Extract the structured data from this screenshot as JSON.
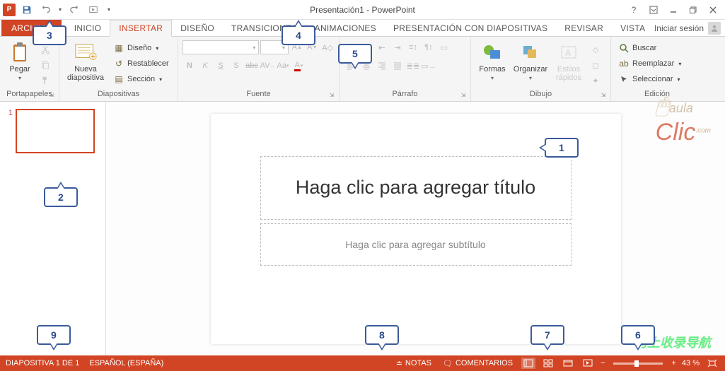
{
  "title": "Presentación1 - PowerPoint",
  "signin": "Iniciar sesión",
  "tabs": {
    "file": "ARCHIVO",
    "home": "INICIO",
    "insert": "INSERTAR",
    "design": "DISEÑO",
    "transitions": "TRANSICIONES",
    "animations": "ANIMACIONES",
    "slideshow": "PRESENTACIÓN CON DIAPOSITIVAS",
    "review": "REVISAR",
    "view": "VISTA"
  },
  "ribbon": {
    "clipboard": {
      "label": "Portapapeles",
      "paste": "Pegar"
    },
    "slides": {
      "label": "Diapositivas",
      "new": "Nueva\ndiapositiva",
      "layout": "Diseño",
      "reset": "Restablecer",
      "section": "Sección"
    },
    "font": {
      "label": "Fuente"
    },
    "paragraph": {
      "label": "Párrafo"
    },
    "drawing": {
      "label": "Dibujo",
      "shapes": "Formas",
      "arrange": "Organizar",
      "styles": "Estilos\nrápidos"
    },
    "editing": {
      "label": "Edición",
      "find": "Buscar",
      "replace": "Reemplazar",
      "select": "Seleccionar"
    }
  },
  "slide": {
    "number": "1",
    "title_placeholder": "Haga clic para agregar título",
    "subtitle_placeholder": "Haga clic para agregar subtítulo"
  },
  "status": {
    "slide_count": "DIAPOSITIVA 1 DE 1",
    "language": "ESPAÑOL (ESPAÑA)",
    "notes": "NOTAS",
    "comments": "COMENTARIOS",
    "zoom": "43 %"
  },
  "callouts": {
    "c1": "1",
    "c2": "2",
    "c3": "3",
    "c4": "4",
    "c5": "5",
    "c7": "7",
    "c8": "8",
    "c9": "9"
  },
  "watermarks": {
    "aula": "aula",
    "clic": "Clic",
    "com": ".com",
    "cn": "马上收录导航"
  }
}
